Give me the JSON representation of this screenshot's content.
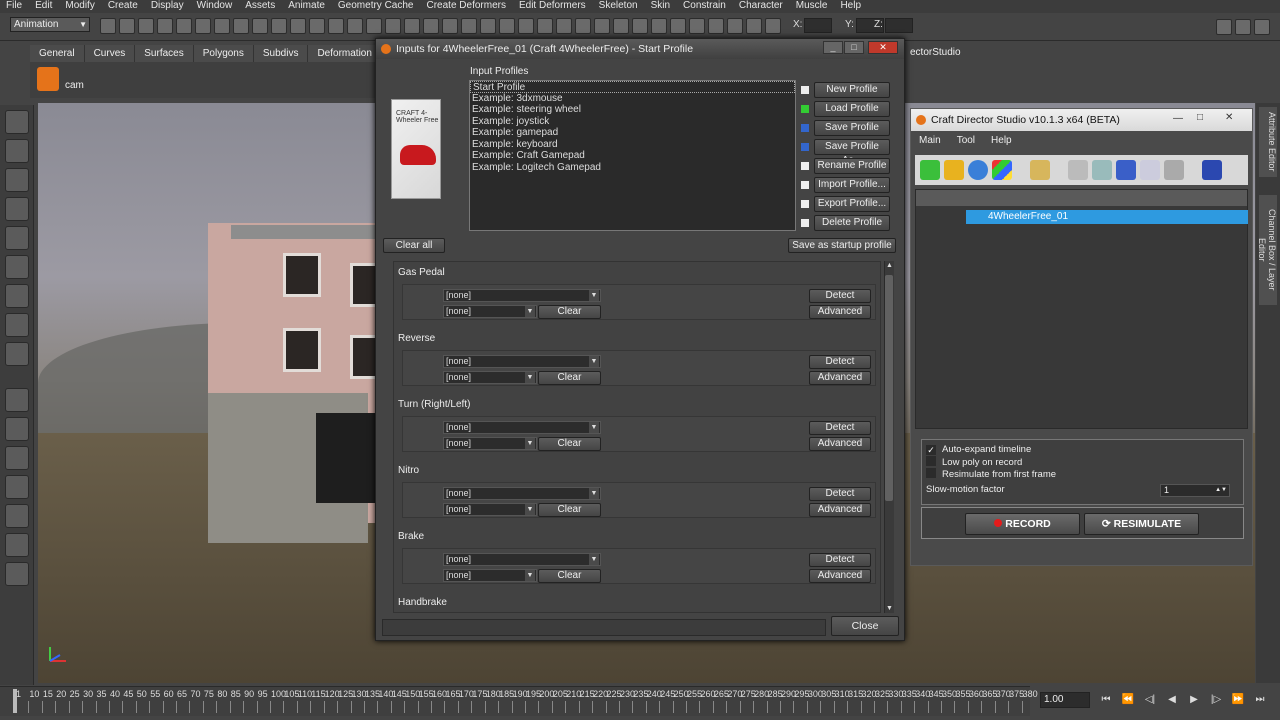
{
  "menubar": [
    "File",
    "Edit",
    "Modify",
    "Create",
    "Display",
    "Window",
    "Assets",
    "Animate",
    "Geometry Cache",
    "Create Deformers",
    "Edit Deformers",
    "Skeleton",
    "Skin",
    "Constrain",
    "Character",
    "Muscle",
    "Help"
  ],
  "mode": "Animation",
  "coords": {
    "x": "X:",
    "y": "Y:",
    "z": "Z:"
  },
  "shelf_tabs": [
    "General",
    "Curves",
    "Surfaces",
    "Polygons",
    "Subdivs",
    "Deformation"
  ],
  "shelf_tab_tail": "ectorStudio",
  "shelf_cam": "cam",
  "right_tabs": [
    "Attribute Editor",
    "Channel Box / Layer Editor"
  ],
  "timeline": {
    "ticks": [
      "1",
      "10",
      "15",
      "20",
      "25",
      "30",
      "35",
      "40",
      "45",
      "50",
      "55",
      "60",
      "65",
      "70",
      "75",
      "80",
      "85",
      "90",
      "95",
      "100",
      "105",
      "110",
      "115",
      "120",
      "125",
      "130",
      "135",
      "140",
      "145",
      "150",
      "155",
      "160",
      "165",
      "170",
      "175",
      "180",
      "185",
      "190",
      "195",
      "200",
      "205",
      "210",
      "215",
      "220",
      "225",
      "230",
      "235",
      "240",
      "245",
      "250",
      "255",
      "260",
      "265",
      "270",
      "275",
      "280",
      "285",
      "290",
      "295",
      "300",
      "305",
      "310",
      "315",
      "320",
      "325",
      "330",
      "335",
      "340",
      "345",
      "350",
      "355",
      "360",
      "365",
      "370",
      "375",
      "380"
    ],
    "current": "1.00"
  },
  "dialog": {
    "title": "Inputs for 4WheelerFree_01 (Craft 4WheelerFree) - Start Profile",
    "profiles_label": "Input Profiles",
    "profiles": [
      "Start Profile",
      "Example: 3dxmouse",
      "Example: steering wheel",
      "Example: joystick",
      "Example: gamepad",
      "Example: keyboard",
      "Example: Craft Gamepad",
      "Example: Logitech Gamepad"
    ],
    "buttons": [
      "New Profile",
      "Load Profile",
      "Save Profile",
      "Save Profile As...",
      "Rename Profile",
      "Import Profile...",
      "Export Profile...",
      "Delete Profile"
    ],
    "clear_all": "Clear all",
    "save_startup": "Save as startup profile",
    "groups": [
      {
        "title": "Gas Pedal",
        "primary": "[none]",
        "secondary": "[none]"
      },
      {
        "title": "Reverse",
        "primary": "[none]",
        "secondary": "[none]"
      },
      {
        "title": "Turn (Right/Left)",
        "primary": "[none]",
        "secondary": "[none]"
      },
      {
        "title": "Nitro",
        "primary": "[none]",
        "secondary": "[none]"
      },
      {
        "title": "Brake",
        "primary": "[none]",
        "secondary": "[none]"
      }
    ],
    "last_group_title": "Handbrake",
    "clear_label": "Clear",
    "detect_label": "Detect",
    "advanced_label": "Advanced",
    "close_label": "Close",
    "box_text": "CRAFT 4-Wheeler Free"
  },
  "craft": {
    "title": "Craft Director Studio v10.1.3 x64 (BETA)",
    "menu": [
      "Main",
      "Tool",
      "Help"
    ],
    "tree_item": "4WheelerFree_01",
    "options": {
      "auto_expand": "Auto-expand timeline",
      "low_poly": "Low poly on record",
      "resimulate_first": "Resimulate from first frame",
      "slowmo_label": "Slow-motion factor",
      "slowmo_value": "1"
    },
    "record": "RECORD",
    "resimulate": "RESIMULATE"
  }
}
